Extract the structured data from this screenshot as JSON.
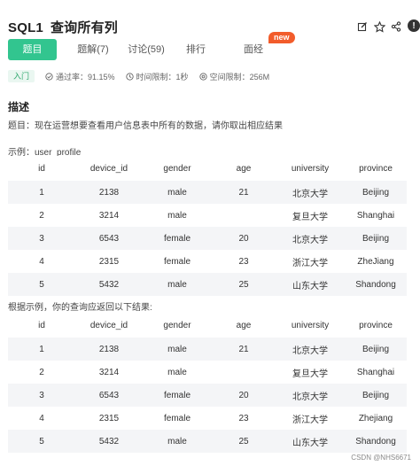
{
  "header": {
    "title_prefix": "SQL1",
    "title": "查询所有列",
    "icons": [
      "edit-icon",
      "star-icon",
      "share-icon",
      "info-icon"
    ],
    "info_glyph": "!"
  },
  "tabs": [
    {
      "label": "题目",
      "active": true
    },
    {
      "label": "题解(7)",
      "active": false
    },
    {
      "label": "讨论(59)",
      "active": false
    },
    {
      "label": "排行",
      "active": false
    },
    {
      "label": "面经",
      "active": false,
      "badge": "new"
    }
  ],
  "meta": {
    "level": "入门",
    "pass_rate": "通过率：91.15%",
    "time_limit": "时间限制：1秒",
    "space_limit": "空间限制：256M"
  },
  "description": {
    "heading": "描述",
    "text": "题目：现在运营想要查看用户信息表中所有的数据，请你取出相应结果",
    "example_label": "示例：user_profile",
    "result_label": "根据示例，你的查询应返回以下结果:"
  },
  "table_columns": [
    "id",
    "device_id",
    "gender",
    "age",
    "university",
    "province"
  ],
  "example_rows": [
    [
      "1",
      "2138",
      "male",
      "21",
      "北京大学",
      "Beijing"
    ],
    [
      "2",
      "3214",
      "male",
      "",
      "复旦大学",
      "Shanghai"
    ],
    [
      "3",
      "6543",
      "female",
      "20",
      "北京大学",
      "Beijing"
    ],
    [
      "4",
      "2315",
      "female",
      "23",
      "浙江大学",
      "ZheJiang"
    ],
    [
      "5",
      "5432",
      "male",
      "25",
      "山东大学",
      "Shandong"
    ]
  ],
  "result_rows": [
    [
      "1",
      "2138",
      "male",
      "21",
      "北京大学",
      "Beijing"
    ],
    [
      "2",
      "3214",
      "male",
      "",
      "复旦大学",
      "Shanghai"
    ],
    [
      "3",
      "6543",
      "female",
      "20",
      "北京大学",
      "Beijing"
    ],
    [
      "4",
      "2315",
      "female",
      "23",
      "浙江大学",
      "Zhejiang"
    ],
    [
      "5",
      "5432",
      "male",
      "25",
      "山东大学",
      "Shandong"
    ]
  ],
  "watermark": "CSDN @NHS6671",
  "colors": {
    "accent": "#32c58f",
    "badge": "#f25c2b",
    "row_stripe": "#f4f5f7"
  }
}
